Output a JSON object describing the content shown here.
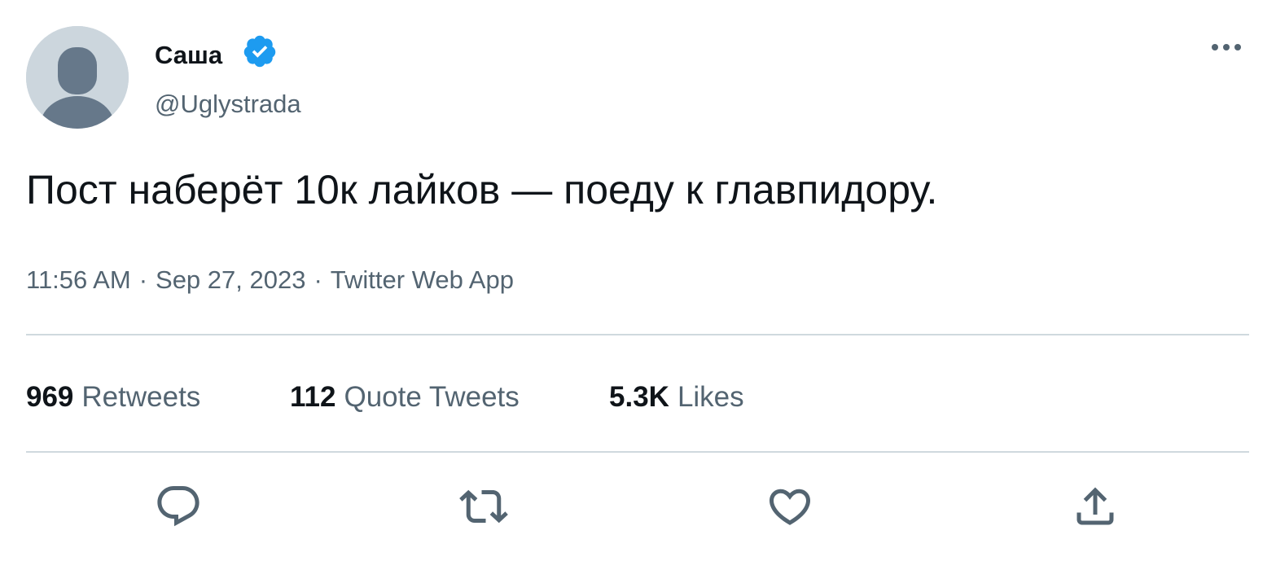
{
  "author": {
    "name": "Саша",
    "handle": "@Uglystrada",
    "verified": true,
    "verified_color": "#1d9bf0"
  },
  "tweet": {
    "text": "Пост наберёт 10к лайков — поеду к главпидору.",
    "time": "11:56 AM",
    "date": "Sep 27, 2023",
    "source": "Twitter Web App",
    "separator": "·"
  },
  "stats": {
    "retweets": {
      "count": "969",
      "label": "Retweets"
    },
    "quotes": {
      "count": "112",
      "label": "Quote Tweets"
    },
    "likes": {
      "count": "5.3K",
      "label": "Likes"
    }
  },
  "actions": [
    {
      "name": "reply",
      "icon": "reply-icon"
    },
    {
      "name": "retweet",
      "icon": "retweet-icon"
    },
    {
      "name": "like",
      "icon": "heart-icon"
    },
    {
      "name": "share",
      "icon": "share-icon"
    }
  ],
  "colors": {
    "text_primary": "#0f1419",
    "text_secondary": "#536471",
    "divider": "#cfd9de",
    "avatar_bg": "#ccd6dd",
    "avatar_fg": "#66788a"
  }
}
